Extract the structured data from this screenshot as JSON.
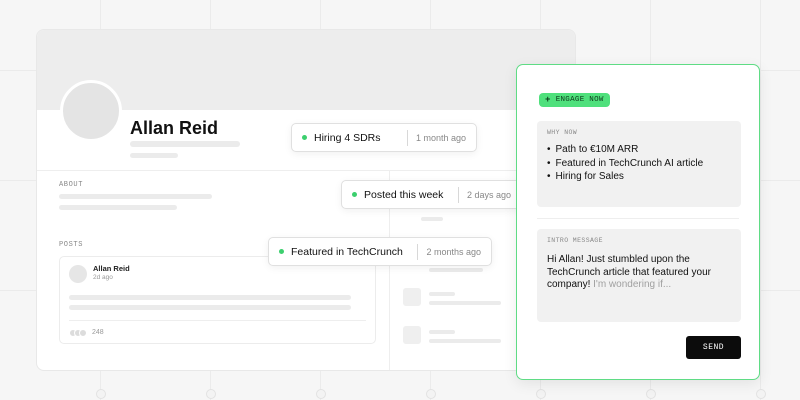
{
  "profile": {
    "name": "Allan Reid",
    "about_label": "ABOUT",
    "posts_label": "POSTS",
    "post": {
      "author": "Allan Reid",
      "time": "2d ago",
      "reaction_count": "248"
    }
  },
  "signals": [
    {
      "text": "Hiring 4 SDRs",
      "time": "1 month ago"
    },
    {
      "text": "Posted this week",
      "time": "2 days ago"
    },
    {
      "text": "Featured in TechCrunch",
      "time": "2 months ago"
    }
  ],
  "panel": {
    "badge_icon": "plus-icon",
    "badge_label": "ENGAGE NOW",
    "why_now_label": "WHY NOW",
    "why_now_items": [
      "Path to €10M ARR",
      "Featured in TechCrunch AI article",
      "Hiring for Sales"
    ],
    "intro_label": "INTRO MESSAGE",
    "intro_text": "Hi Allan! Just stumbled upon the TechCrunch article that featured your company!",
    "intro_faded": "I'm wondering if...",
    "send_label": "SEND"
  },
  "colors": {
    "accent_green": "#4fe07c",
    "panel_border": "#5fdc85",
    "send_button": "#0c0c0c"
  }
}
